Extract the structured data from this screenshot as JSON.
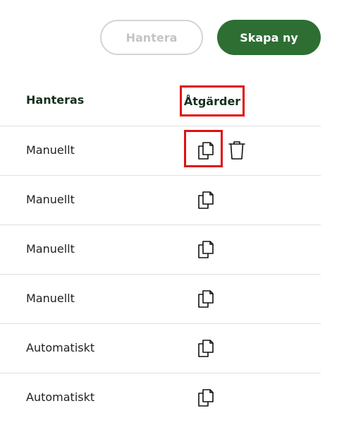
{
  "toolbar": {
    "manage_label": "Hantera",
    "create_label": "Skapa ny"
  },
  "table": {
    "headers": {
      "managed": "Hanteras",
      "actions": "Åtgärder"
    },
    "rows": [
      {
        "managed": "Manuellt",
        "actions": [
          "copy-icon",
          "trash-icon"
        ]
      },
      {
        "managed": "Manuellt",
        "actions": [
          "copy-icon"
        ]
      },
      {
        "managed": "Manuellt",
        "actions": [
          "copy-icon"
        ]
      },
      {
        "managed": "Manuellt",
        "actions": [
          "copy-icon"
        ]
      },
      {
        "managed": "Automatiskt",
        "actions": [
          "copy-icon"
        ]
      },
      {
        "managed": "Automatiskt",
        "actions": [
          "copy-icon"
        ]
      }
    ]
  },
  "colors": {
    "primary_button": "#2e6e33",
    "highlight": "#e01010",
    "disabled_text": "#c4c4c4",
    "divider": "#e0e0e0"
  }
}
